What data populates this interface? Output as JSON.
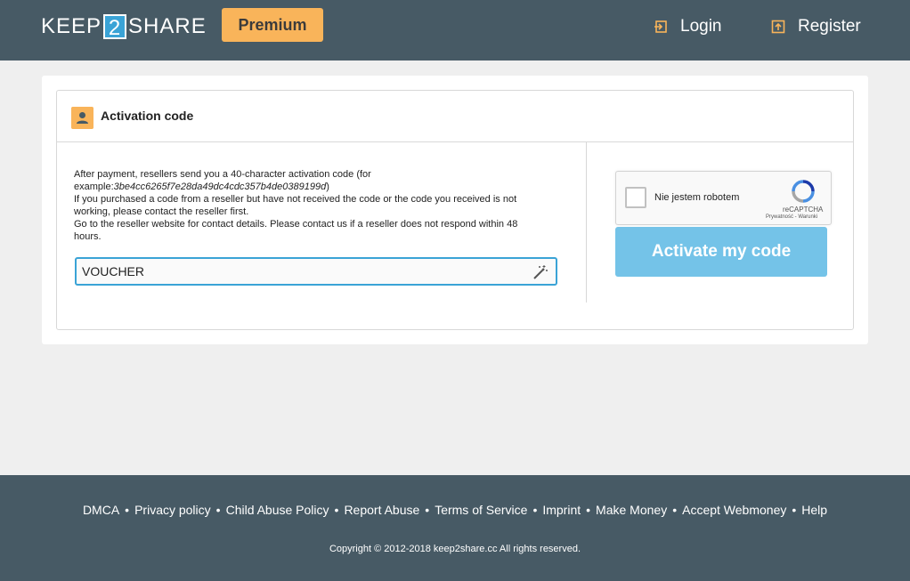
{
  "header": {
    "logo_left": "KEEP",
    "logo_mid": "2",
    "logo_right": "SHARE",
    "premium_label": "Premium",
    "login_label": "Login",
    "register_label": "Register"
  },
  "card": {
    "title": "Activation code",
    "info_line1": "After payment, resellers send you a 40-character activation code (for",
    "info_example_prefix": "example:",
    "info_example_code": "3be4cc6265f7e28da49dc4cdc357b4de0389199d",
    "info_line3": "If you purchased a code from a reseller but have not received the code or the code you received is not",
    "info_line4": "working, please contact the reseller first.",
    "info_line5": "Go to the reseller website for contact details. Please contact us if a reseller does not respond within 48",
    "info_line6": "hours.",
    "code_value": "VOUCHER",
    "activate_label": "Activate my code"
  },
  "recaptcha": {
    "label": "Nie jestem robotem",
    "brand": "reCAPTCHA",
    "links": "Prywatność - Warunki"
  },
  "footer": {
    "links": [
      "DMCA",
      "Privacy policy",
      "Child Abuse Policy",
      "Report Abuse",
      "Terms of Service",
      "Imprint",
      "Make Money",
      "Accept Webmoney",
      "Help"
    ],
    "separator": "•",
    "copyright": "Copyright © 2012-2018 keep2share.cc All rights reserved."
  },
  "colors": {
    "header_bg": "#475a65",
    "accent_orange": "#f9b45a",
    "accent_blue": "#3aa3d6",
    "button_blue": "#74c3e8"
  },
  "icons": {
    "login": "login-arrow-icon",
    "register": "register-upload-icon",
    "user": "user-icon",
    "wand": "magic-wand-icon",
    "recaptcha": "recaptcha-logo-icon"
  }
}
